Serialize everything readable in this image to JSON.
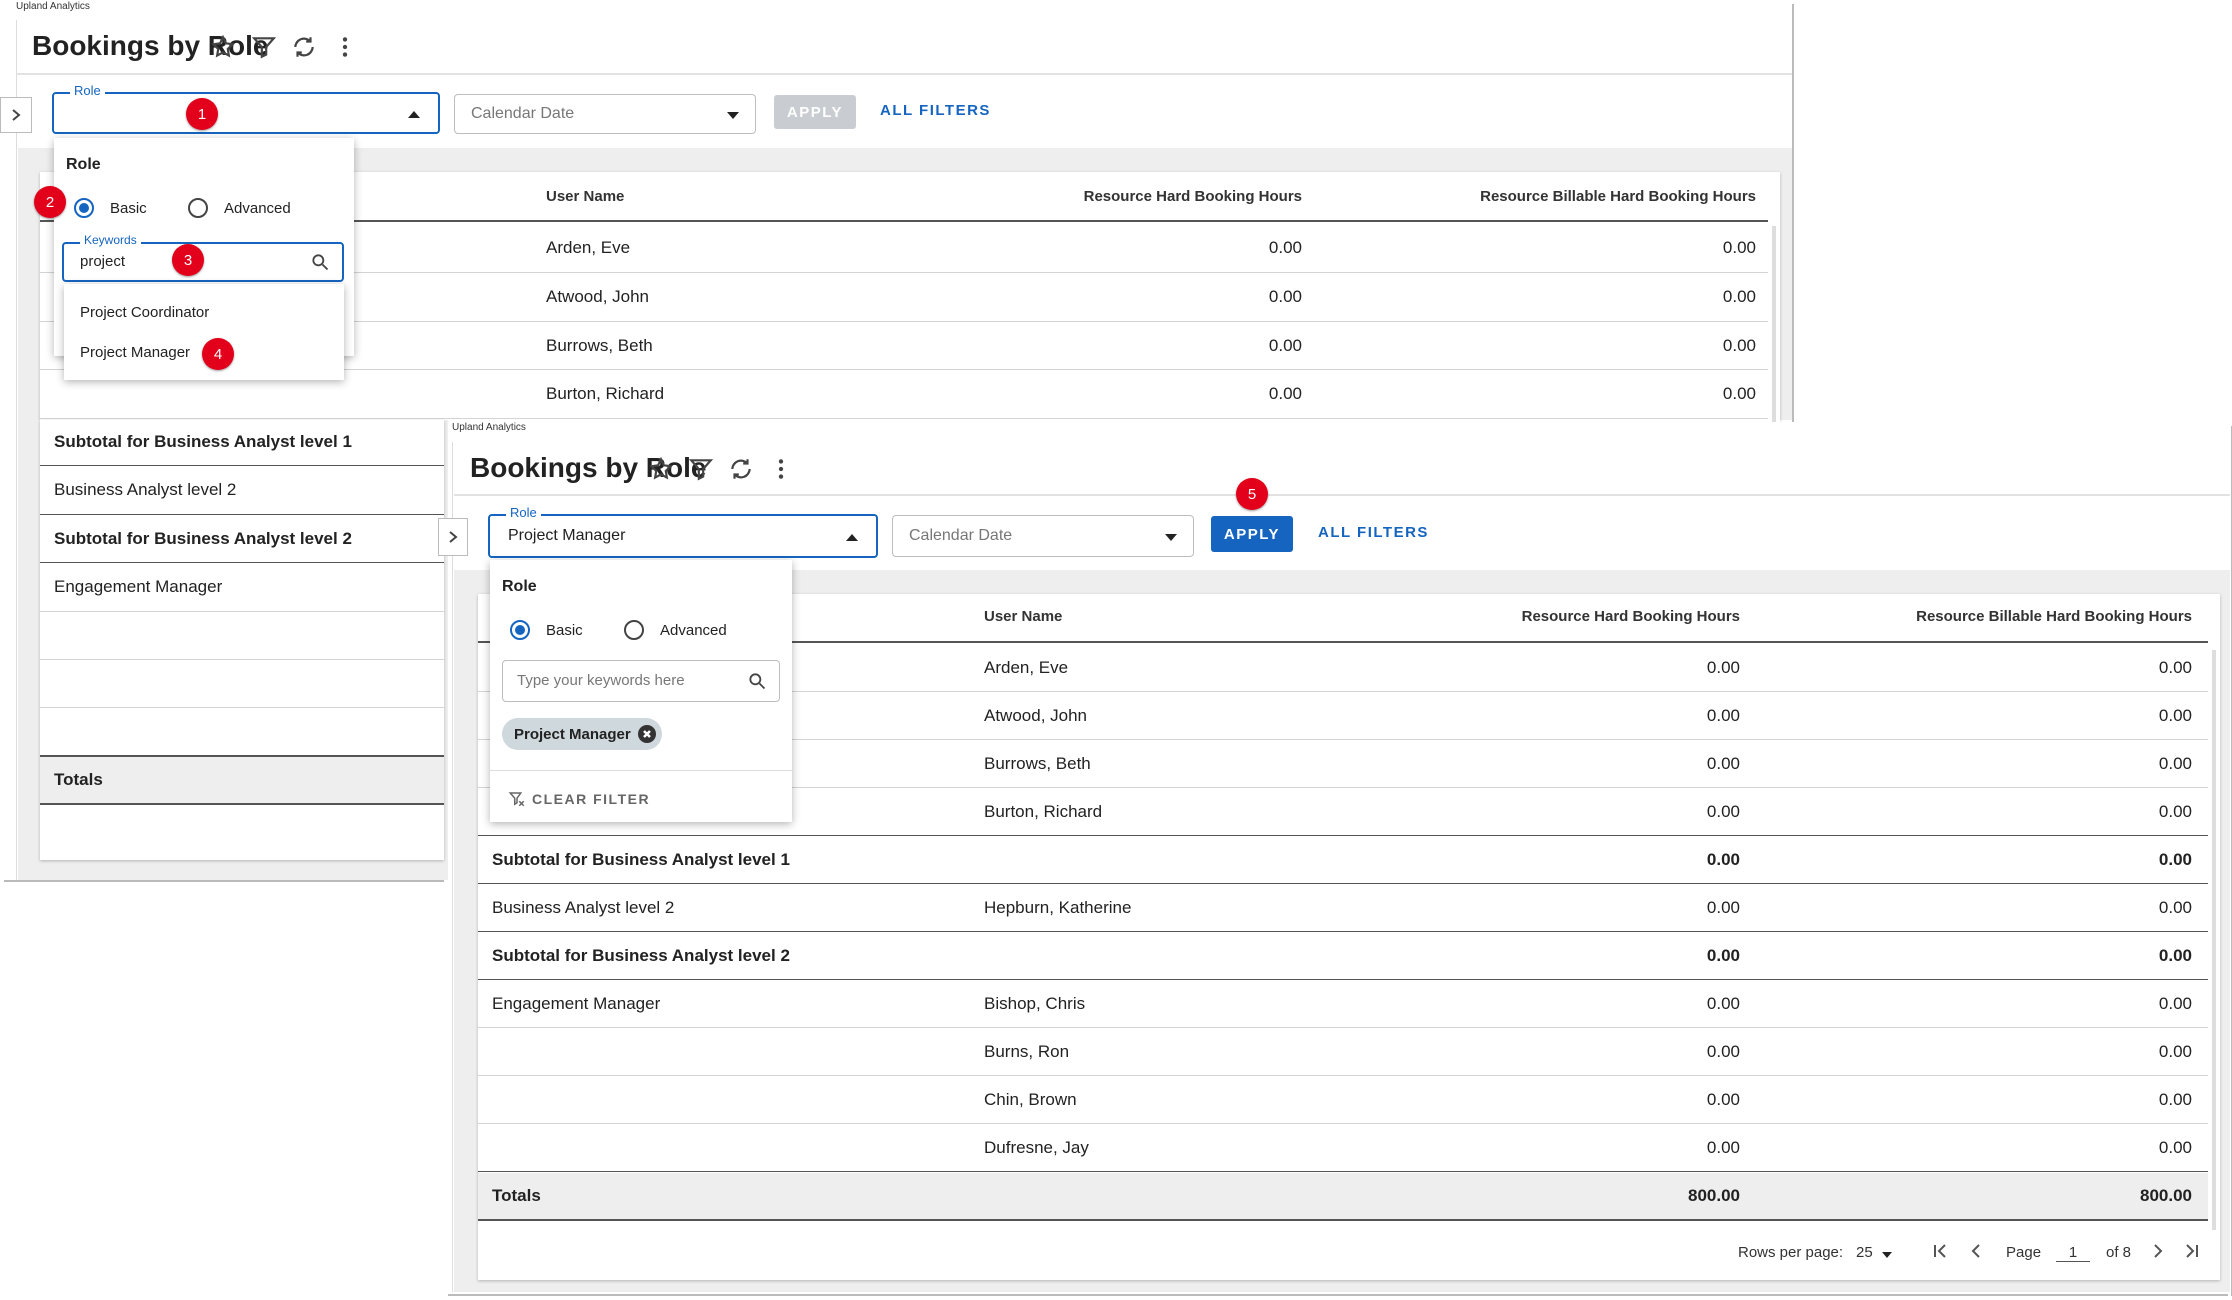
{
  "colors": {
    "accent": "#1565c0",
    "badge": "#e3001b",
    "apply_disabled": "#c9cdd1"
  },
  "back": {
    "app_label": "Upland Analytics",
    "title": "Bookings by Role",
    "role_field": {
      "label": "Role",
      "value": ""
    },
    "date_field": {
      "placeholder": "Calendar Date"
    },
    "apply_label": "APPLY",
    "all_filters_label": "ALL FILTERS",
    "columns": [
      "User Name",
      "Resource Hard Booking Hours",
      "Resource Billable Hard Booking Hours"
    ],
    "rows": [
      {
        "user": "Arden, Eve",
        "hard": "0.00",
        "billable": "0.00"
      },
      {
        "user": "Atwood, John",
        "hard": "0.00",
        "billable": "0.00"
      },
      {
        "user": "Burrows, Beth",
        "hard": "0.00",
        "billable": "0.00"
      },
      {
        "user": "Burton, Richard",
        "hard": "0.00",
        "billable": "0.00"
      }
    ],
    "left_rows": [
      "Subtotal for Business Analyst level 1",
      "Business Analyst level 2",
      "Subtotal for Business Analyst level 2",
      "Engagement Manager",
      "",
      "",
      "",
      "Totals"
    ],
    "dropdown": {
      "title": "Role",
      "radio_basic": "Basic",
      "radio_advanced": "Advanced",
      "keywords_label": "Keywords",
      "keywords_value": "project",
      "options": [
        "Project Coordinator",
        "Project Manager"
      ]
    },
    "badges": [
      "1",
      "2",
      "3",
      "4"
    ]
  },
  "front": {
    "app_label": "Upland Analytics",
    "title": "Bookings by Role",
    "role_field": {
      "label": "Role",
      "value": "Project Manager"
    },
    "date_field": {
      "placeholder": "Calendar Date"
    },
    "apply_label": "APPLY",
    "all_filters_label": "ALL FILTERS",
    "columns": [
      "User Name",
      "Resource Hard Booking Hours",
      "Resource Billable Hard Booking Hours"
    ],
    "rows": [
      {
        "role": "",
        "user": "Arden, Eve",
        "hard": "0.00",
        "billable": "0.00",
        "bold": false
      },
      {
        "role": "",
        "user": "Atwood, John",
        "hard": "0.00",
        "billable": "0.00",
        "bold": false
      },
      {
        "role": "",
        "user": "Burrows, Beth",
        "hard": "0.00",
        "billable": "0.00",
        "bold": false
      },
      {
        "role": "",
        "user": "Burton, Richard",
        "hard": "0.00",
        "billable": "0.00",
        "bold": false
      },
      {
        "role": "Subtotal for Business Analyst level 1",
        "user": "",
        "hard": "0.00",
        "billable": "0.00",
        "bold": true
      },
      {
        "role": "Business Analyst level 2",
        "user": "Hepburn, Katherine",
        "hard": "0.00",
        "billable": "0.00",
        "bold": false
      },
      {
        "role": "Subtotal for Business Analyst level 2",
        "user": "",
        "hard": "0.00",
        "billable": "0.00",
        "bold": true
      },
      {
        "role": "Engagement Manager",
        "user": "Bishop, Chris",
        "hard": "0.00",
        "billable": "0.00",
        "bold": false
      },
      {
        "role": "",
        "user": "Burns, Ron",
        "hard": "0.00",
        "billable": "0.00",
        "bold": false
      },
      {
        "role": "",
        "user": "Chin, Brown",
        "hard": "0.00",
        "billable": "0.00",
        "bold": false
      },
      {
        "role": "",
        "user": "Dufresne, Jay",
        "hard": "0.00",
        "billable": "0.00",
        "bold": false
      }
    ],
    "totals": {
      "label": "Totals",
      "hard": "800.00",
      "billable": "800.00"
    },
    "dropdown": {
      "title": "Role",
      "radio_basic": "Basic",
      "radio_advanced": "Advanced",
      "search_placeholder": "Type your keywords here",
      "chip": "Project Manager",
      "clear_label": "CLEAR FILTER"
    },
    "pagination": {
      "rows_label": "Rows per page:",
      "rows_value": "25",
      "page_label": "Page",
      "page_value": "1",
      "of_label": "of 8"
    },
    "badge": "5"
  }
}
